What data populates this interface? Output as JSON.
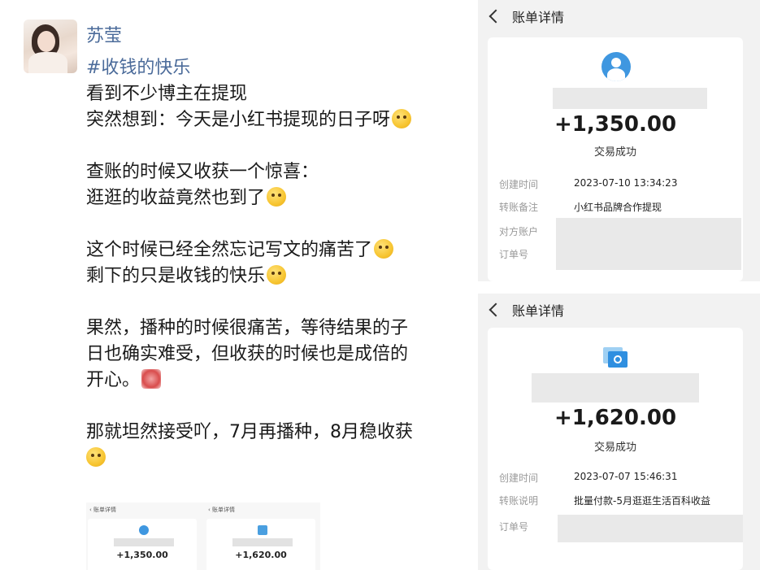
{
  "post": {
    "username": "苏莹",
    "hashtag": "#收钱的快乐",
    "paragraphs": [
      [
        "看到不少博主在提现",
        "突然想到：今天是小红书提现的日子呀"
      ],
      [
        "查账的时候又收获一个惊喜：",
        "逛逛的收益竟然也到了"
      ],
      [
        "这个时候已经全然忘记写文的痛苦了",
        "剩下的只是收钱的快乐"
      ],
      [
        "果然，播种的时候很痛苦，等待结果的子",
        "日也确实难受，但收获的时候也是成倍的",
        "开心。"
      ],
      [
        "那就坦然接受吖，7月再播种，8月稳收获"
      ]
    ],
    "thumbnails": [
      {
        "header": "账单详情",
        "amount": "+1,350.00"
      },
      {
        "header": "账单详情",
        "amount": "+1,620.00"
      }
    ]
  },
  "bill1": {
    "title": "账单详情",
    "amount": "+1,350.00",
    "status": "交易成功",
    "rows": [
      {
        "label": "创建时间",
        "value": "2023-07-10 13:34:23"
      },
      {
        "label": "转账备注",
        "value": "小红书品牌合作提现"
      },
      {
        "label": "对方账户",
        "value": ""
      },
      {
        "label": "订单号",
        "value": ""
      }
    ]
  },
  "bill2": {
    "title": "账单详情",
    "amount": "+1,620.00",
    "status": "交易成功",
    "rows": [
      {
        "label": "创建时间",
        "value": "2023-07-07 15:46:31"
      },
      {
        "label": "转账说明",
        "value": "批量付款-5月逛逛生活百科收益"
      },
      {
        "label": "订单号",
        "value": ""
      }
    ]
  }
}
